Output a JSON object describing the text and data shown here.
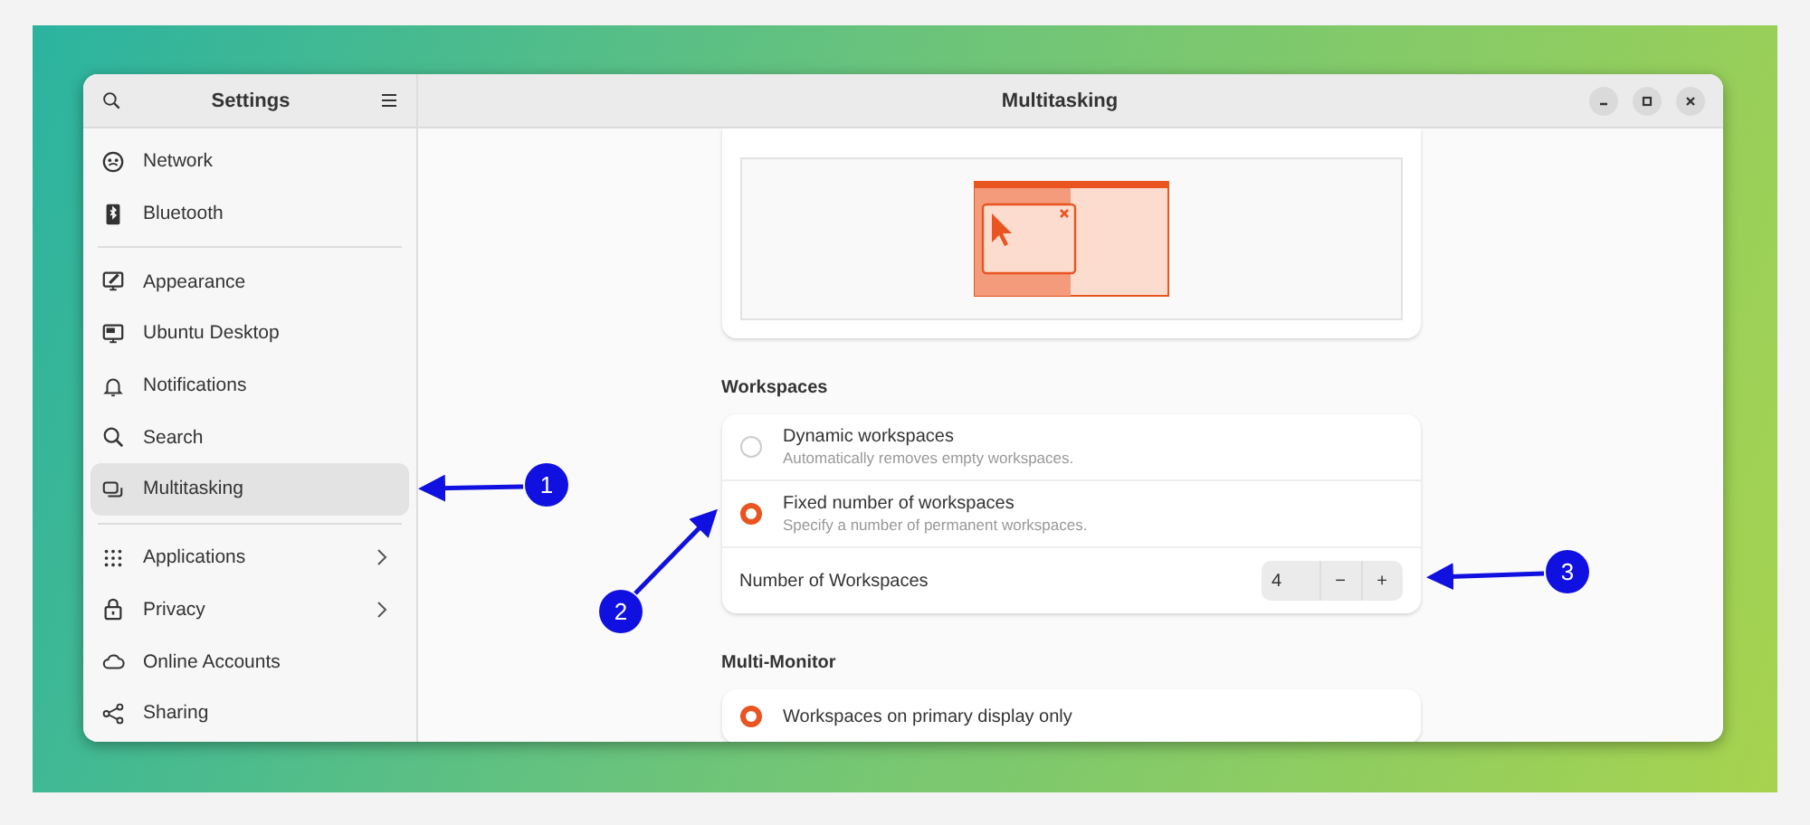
{
  "sidebar": {
    "title": "Settings",
    "groups": [
      [
        {
          "label": "Network",
          "selected": false,
          "submenu": false
        },
        {
          "label": "Bluetooth",
          "selected": false,
          "submenu": false
        }
      ],
      [
        {
          "label": "Appearance",
          "selected": false,
          "submenu": false
        },
        {
          "label": "Ubuntu Desktop",
          "selected": false,
          "submenu": false
        },
        {
          "label": "Notifications",
          "selected": false,
          "submenu": false
        },
        {
          "label": "Search",
          "selected": false,
          "submenu": false
        },
        {
          "label": "Multitasking",
          "selected": true,
          "submenu": false
        }
      ],
      [
        {
          "label": "Applications",
          "selected": false,
          "submenu": true
        },
        {
          "label": "Privacy",
          "selected": false,
          "submenu": true
        },
        {
          "label": "Online Accounts",
          "selected": false,
          "submenu": false
        },
        {
          "label": "Sharing",
          "selected": false,
          "submenu": false
        }
      ]
    ]
  },
  "window": {
    "title": "Multitasking"
  },
  "sections": [
    {
      "kind": "illustration"
    },
    {
      "kind": "options",
      "heading": "Workspaces",
      "options": [
        {
          "kind": "radio",
          "label": "Dynamic workspaces",
          "description": "Automatically removes empty workspaces.",
          "selected": false
        },
        {
          "kind": "radio",
          "label": "Fixed number of workspaces",
          "description": "Specify a number of permanent workspaces.",
          "selected": true
        },
        {
          "kind": "spin",
          "label": "Number of Workspaces",
          "value": "4",
          "minus": "−",
          "plus": "+"
        }
      ]
    },
    {
      "kind": "options",
      "heading": "Multi-Monitor",
      "options": [
        {
          "kind": "radio",
          "label": "Workspaces on primary display only",
          "selected": true
        }
      ]
    }
  ],
  "annotations": [
    {
      "label": "1"
    },
    {
      "label": "2"
    },
    {
      "label": "3"
    }
  ]
}
